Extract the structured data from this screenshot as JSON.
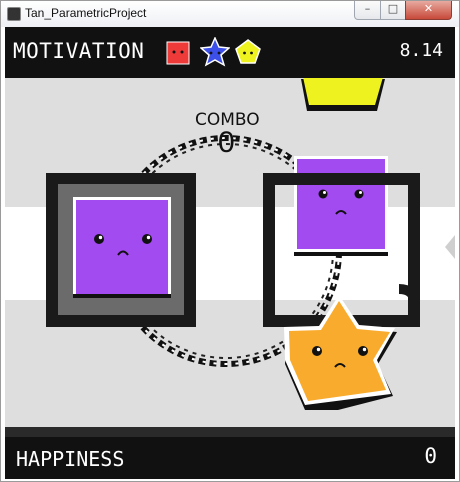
{
  "window": {
    "title": "Tan_ParametricProject"
  },
  "hud": {
    "motivation_label": "MOTIVATION",
    "motivation_value": "8.14",
    "happiness_label": "HAPPINESS",
    "happiness_value": "0",
    "combo_label": "COMBO",
    "combo_value": "0"
  },
  "colors": {
    "purple": "#a24bf0",
    "orange": "#f9ab2e",
    "yellow": "#eef21f",
    "red": "#ef3a3a",
    "blue": "#3c4fe8",
    "hud_bg": "#111111",
    "lane": "#ffffff",
    "field": "#dedede"
  },
  "icons": [
    "red-square-icon",
    "blue-star-icon",
    "yellow-pentagon-icon"
  ]
}
